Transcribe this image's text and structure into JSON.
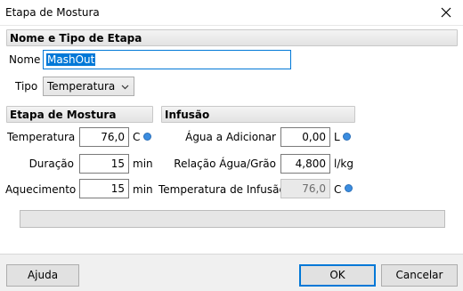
{
  "window": {
    "title": "Etapa de Mostura"
  },
  "step": {
    "header": "Nome e Tipo de Etapa",
    "name_label": "Nome",
    "name_value": "MashOut",
    "type_label": "Tipo",
    "type_value": "Temperatura"
  },
  "mash_step": {
    "header": "Etapa de Mostura",
    "temperature_label": "Temperatura",
    "temperature_value": "76,0",
    "temperature_unit": "C",
    "duration_label": "Duração",
    "duration_value": "15",
    "duration_unit": "min",
    "heating_label": "Aquecimento",
    "heating_value": "15",
    "heating_unit": "min"
  },
  "infusion": {
    "header": "Infusão",
    "water_label": "Água a Adicionar",
    "water_value": "0,00",
    "water_unit": "L",
    "ratio_label": "Relação Água/Grão",
    "ratio_value": "4,800",
    "ratio_unit": "l/kg",
    "infusion_temp_label": "Temperatura de Infusão",
    "infusion_temp_value": "76,0",
    "infusion_temp_unit": "C"
  },
  "progress": {
    "value": 0
  },
  "buttons": {
    "help": "Ajuda",
    "ok": "OK",
    "cancel": "Cancelar"
  },
  "colors": {
    "accent": "#0078d7",
    "indicator": "#3b8de0"
  },
  "icons": {
    "close": "close-icon",
    "dropdown": "chevron-down-icon",
    "indicator": "blue-dot-icon"
  }
}
